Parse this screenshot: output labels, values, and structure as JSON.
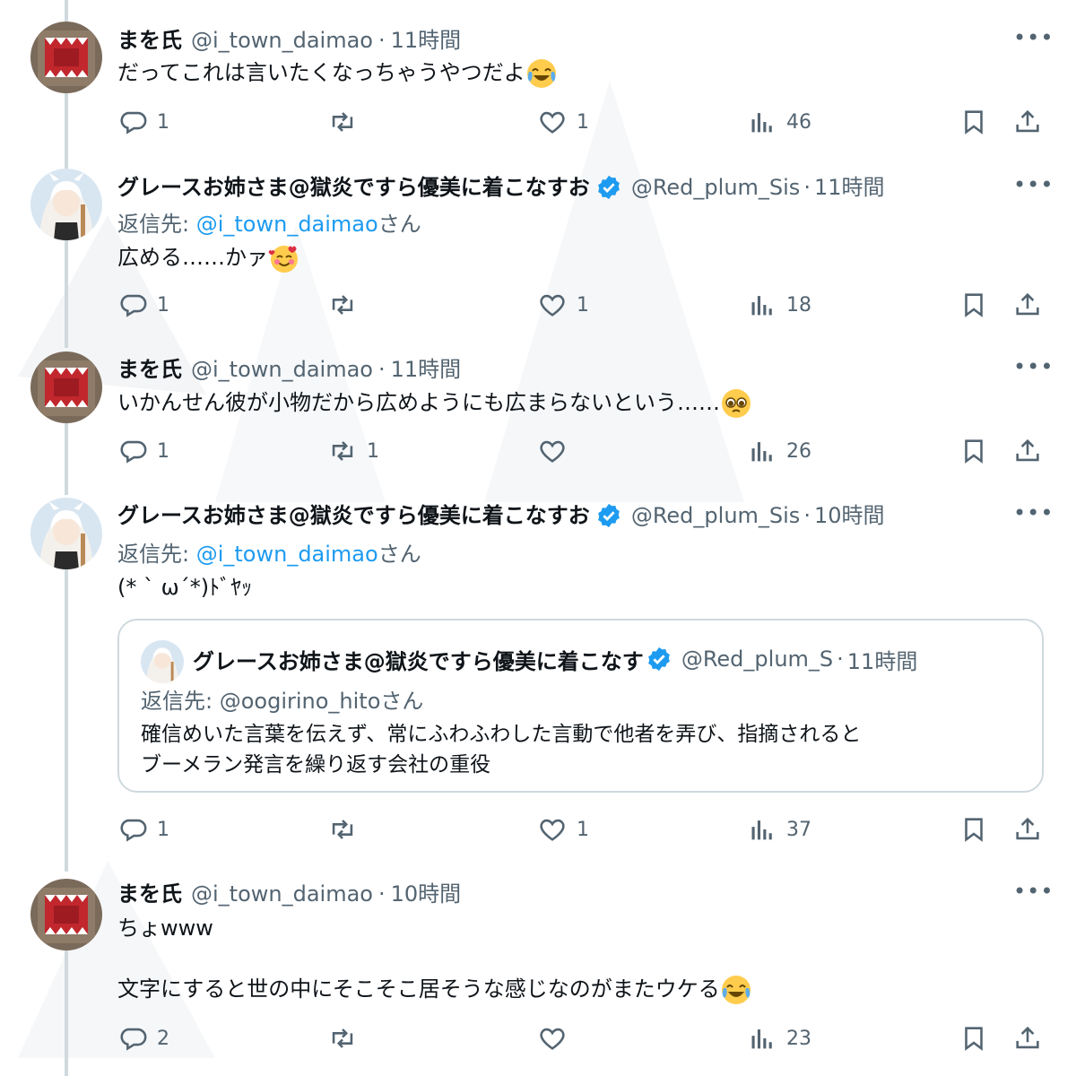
{
  "tweets": [
    {
      "name": "まを氏",
      "handle": "@i_town_daimao",
      "dot": "·",
      "time": "11時間",
      "reply_to": null,
      "text": "だってこれは言いたくなっちゃうやつだよ",
      "emoji": "face-with-tears-of-joy",
      "replies": "1",
      "retweets": "",
      "likes": "1",
      "views": "46"
    },
    {
      "name": "グレースお姉さま@獄炎ですら優美に着こなすお",
      "handle": "@Red_plum_Sis",
      "dot": "·",
      "time": "11時間",
      "reply_prefix": "返信先: ",
      "reply_mention": "@i_town_daimao",
      "reply_suffix": "さん",
      "text": "広める……かァ",
      "emoji": "smiling-face-with-hearts",
      "replies": "1",
      "retweets": "",
      "likes": "1",
      "views": "18"
    },
    {
      "name": "まを氏",
      "handle": "@i_town_daimao",
      "dot": "·",
      "time": "11時間",
      "text": "いかんせん彼が小物だから広めようにも広まらないという……",
      "emoji": "pleading-face",
      "replies": "1",
      "retweets": "1",
      "likes": "",
      "views": "26"
    },
    {
      "name": "グレースお姉さま@獄炎ですら優美に着こなすお",
      "handle": "@Red_plum_Sis",
      "dot": "·",
      "time": "10時間",
      "reply_prefix": "返信先: ",
      "reply_mention": "@i_town_daimao",
      "reply_suffix": "さん",
      "text": "(* ` ω´*)ﾄﾞﾔｯ",
      "quote": {
        "name": "グレースお姉さま@獄炎ですら優美に着こなす",
        "handle": "@Red_plum_S",
        "dot": "·",
        "time": "11時間",
        "reply_to": "返信先: @oogirino_hitoさん",
        "text_line1": "確信めいた言葉を伝えず、常にふわふわした言動で他者を弄び、指摘されると",
        "text_line2": "ブーメラン発言を繰り返す会社の重役"
      },
      "replies": "1",
      "retweets": "",
      "likes": "1",
      "views": "37"
    },
    {
      "name": "まを氏",
      "handle": "@i_town_daimao",
      "dot": "·",
      "time": "10時間",
      "text_line1": "ちょwww",
      "text_line2": "文字にすると世の中にそこそこ居そうな感じなのがまたウケる",
      "emoji": "face-with-tears-of-joy",
      "replies": "2",
      "retweets": "",
      "likes": "",
      "views": "23"
    }
  ],
  "more_label": "•••",
  "colors": {
    "text": "#0f1419",
    "secondary": "#536471",
    "accent": "#1d9bf0",
    "border": "#cfd9de"
  }
}
